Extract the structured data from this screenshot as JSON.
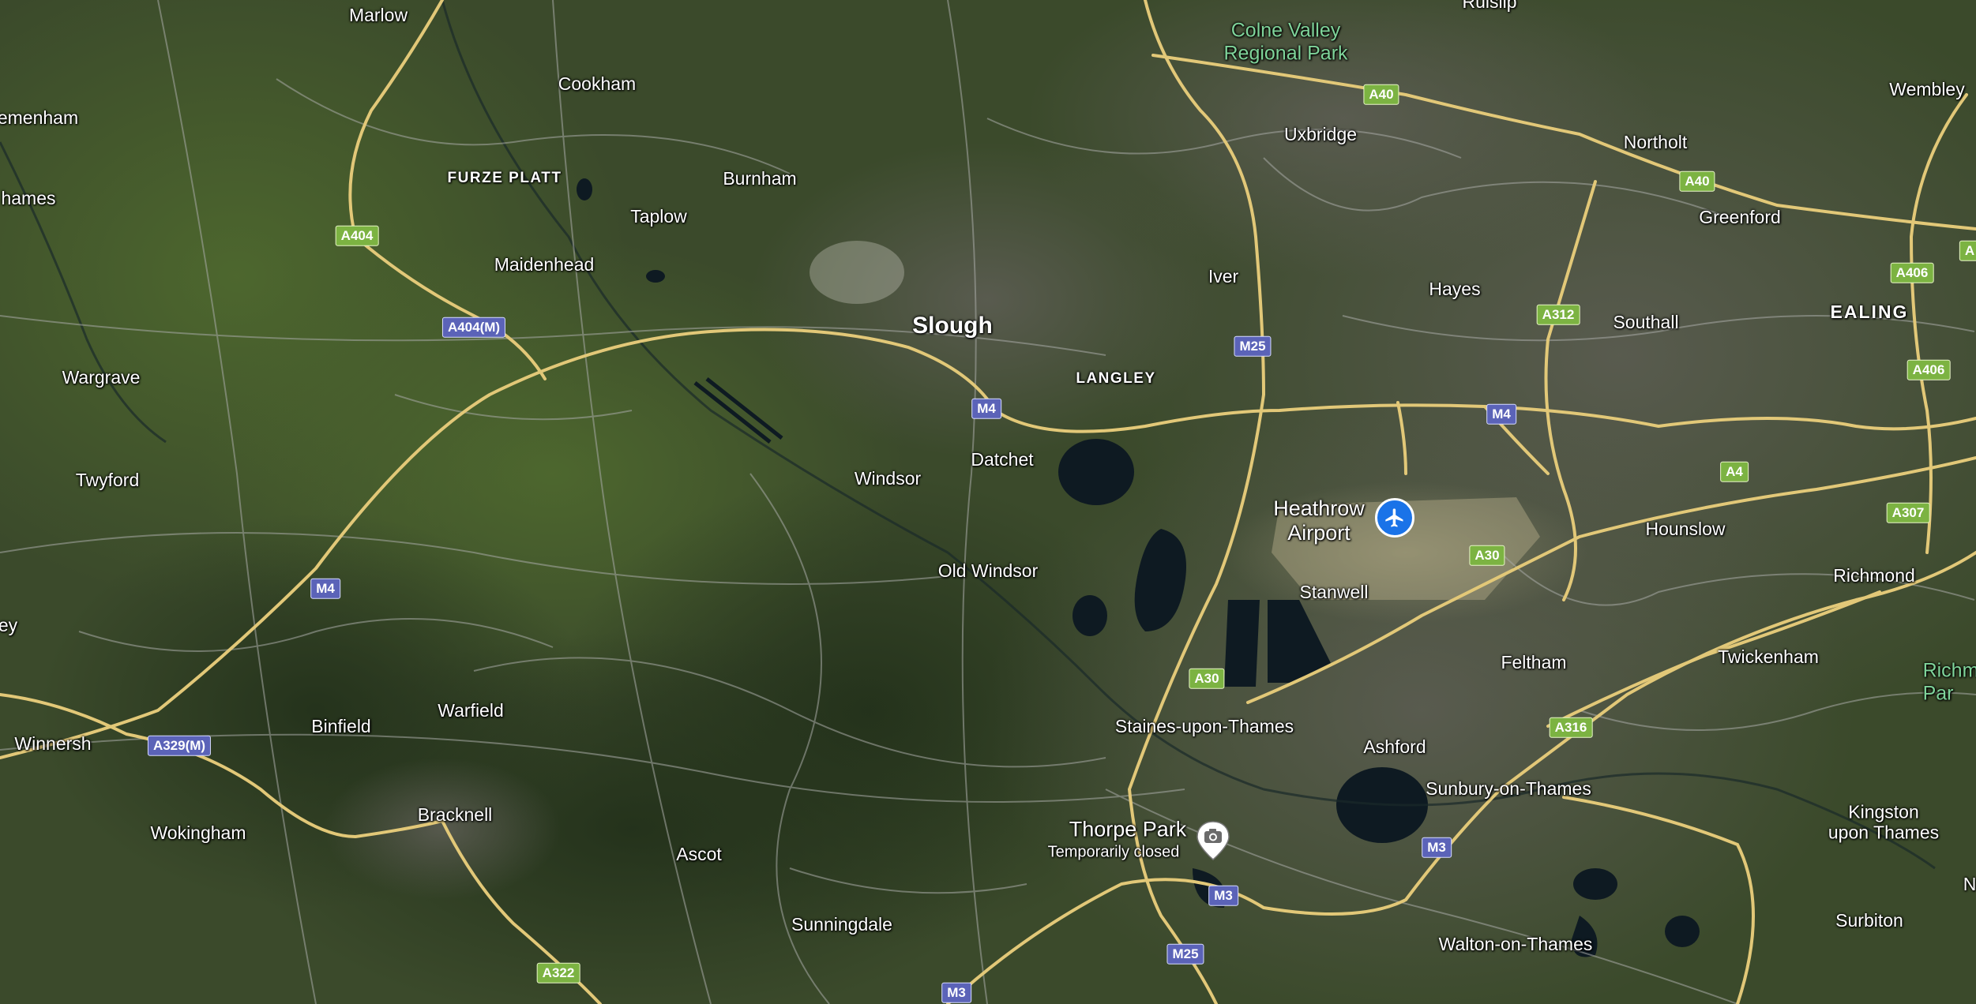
{
  "map": {
    "view": "satellite",
    "colors": {
      "land": "#39472a",
      "road_major": "#e2c878",
      "road_minor": "#a7a9a5",
      "water": "#0e1a22",
      "a_road_shield": "#7cb342",
      "motorway_shield": "#5b63b8",
      "park_label": "#7fd49a",
      "airport_pin": "#1a73e8"
    },
    "places": {
      "marlow": "Marlow",
      "ruislip": "Ruislip",
      "colne_valley": "Colne Valley\nRegional Park",
      "cookham": "Cookham",
      "uxbridge": "Uxbridge",
      "wembley": "Wembley",
      "medmenham": "emenham",
      "northolt": "Northolt",
      "furze_platt": "FURZE PLATT",
      "burnham": "Burnham",
      "thames": "hames",
      "taplow": "Taplow",
      "greenford": "Greenford",
      "maidenhead": "Maidenhead",
      "iver": "Iver",
      "hayes": "Hayes",
      "slough": "Slough",
      "southall": "Southall",
      "ealing": "EALING",
      "wargrave": "Wargrave",
      "langley": "LANGLEY",
      "datchet": "Datchet",
      "twyford": "Twyford",
      "windsor": "Windsor",
      "heathrow": "Heathrow\nAirport",
      "hounslow": "Hounslow",
      "old_windsor": "Old Windsor",
      "stanwell": "Stanwell",
      "richmond": "Richmond",
      "ey": "ey",
      "feltham": "Feltham",
      "twickenham": "Twickenham",
      "richmond_park": "Richm\nPar",
      "binfield": "Binfield",
      "warfield": "Warfield",
      "staines": "Staines-upon-Thames",
      "winnersh": "Winnersh",
      "ashford": "Ashford",
      "sunbury": "Sunbury-on-Thames",
      "bracknell": "Bracknell",
      "kingston": "Kingston\nupon Thames",
      "thorpe_park": "Thorpe Park",
      "thorpe_park_status": "Temporarily closed",
      "wokingham": "Wokingham",
      "ascot": "Ascot",
      "sunningdale": "Sunningdale",
      "surbiton": "Surbiton",
      "walton": "Walton-on-Thames",
      "n_edge": "N"
    },
    "shields": {
      "a40_1": "A40",
      "a40_2": "A40",
      "a404": "A404",
      "a404m": "A404(M)",
      "a406_1": "A406",
      "a406_2": "A406",
      "a312": "A312",
      "m25_1": "M25",
      "m4_1": "M4",
      "m4_2": "M4",
      "m4_3": "M4",
      "a4": "A4",
      "a307": "A307",
      "a30_1": "A30",
      "a30_2": "A30",
      "a329m": "A329(M)",
      "a316": "A316",
      "m3_1": "M3",
      "m3_2": "M3",
      "m3_3": "M3",
      "m25_2": "M25",
      "a322": "A322",
      "a_edge": "A"
    },
    "icons": {
      "airport": "airplane-icon",
      "poi": "camera-icon"
    }
  }
}
